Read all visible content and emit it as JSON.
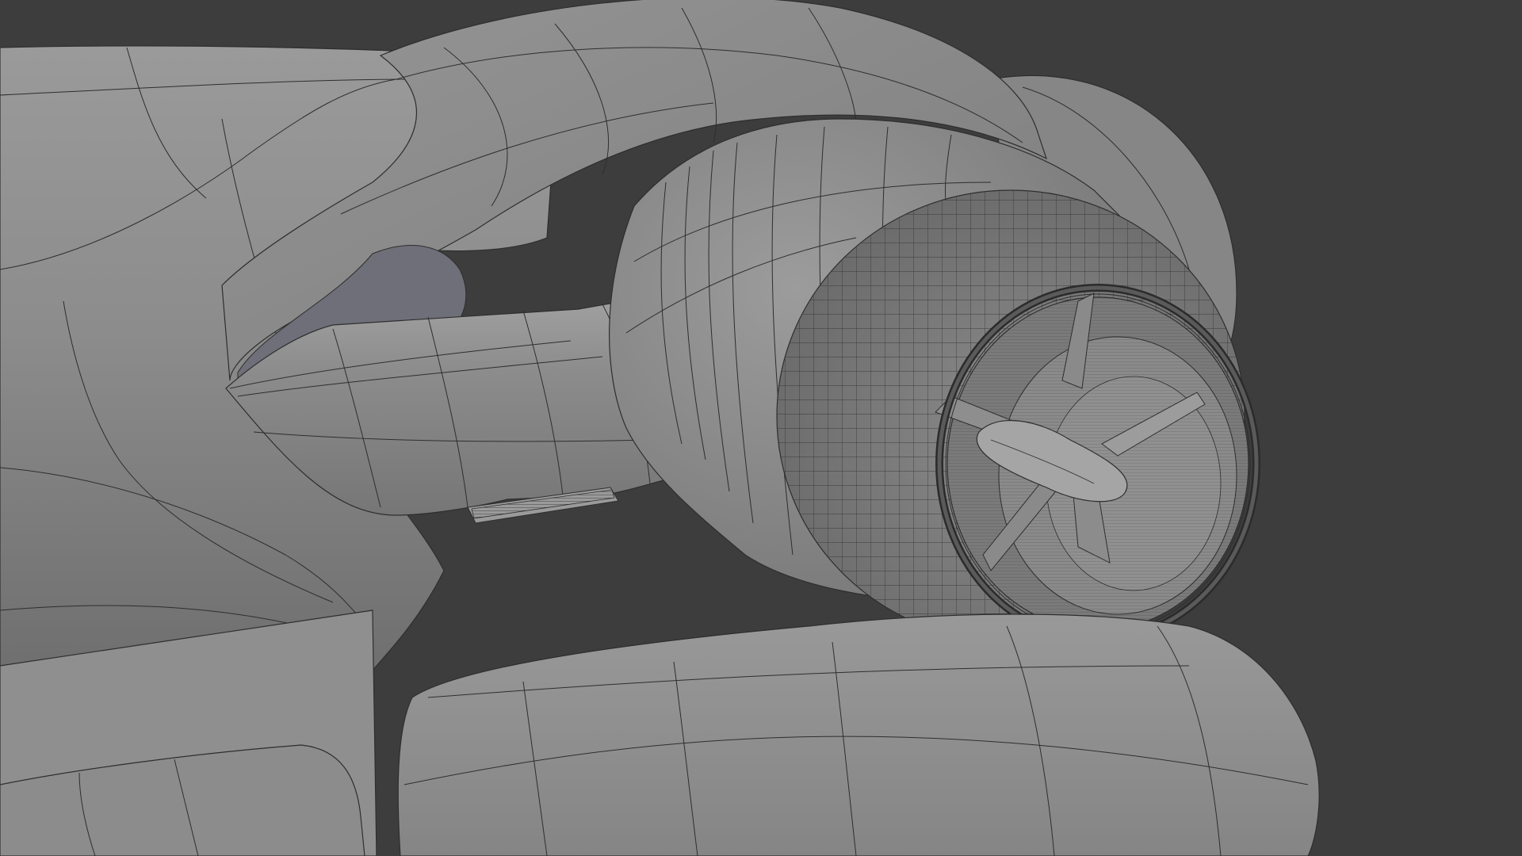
{
  "viewport": {
    "background_color": "#3d3d3d",
    "mesh_color": "#8a8a8a",
    "wire_color": "#2a2a2a",
    "shading": "solid",
    "overlay": "wireframe"
  },
  "model": {
    "parts": [
      "fuselage",
      "pylon-arch",
      "engine-arm",
      "engine-nacelle",
      "intake-lip",
      "intake-mesh",
      "fan-spinner",
      "fan-blades",
      "lower-pod",
      "side-panel",
      "lower-left-block"
    ]
  }
}
